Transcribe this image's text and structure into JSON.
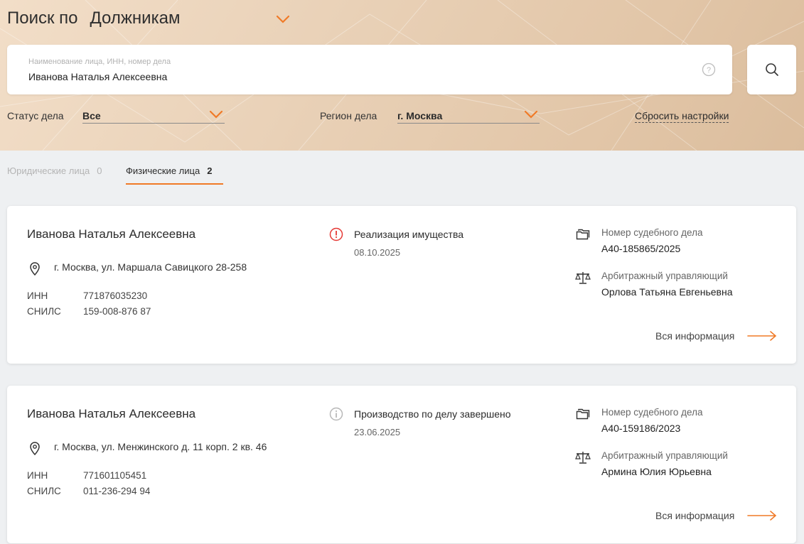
{
  "header": {
    "title_prefix": "Поиск по",
    "title_select": "Должникам",
    "search": {
      "placeholder": "Наименование лица, ИНН, номер дела",
      "value": "Иванова Наталья Алексеевна"
    },
    "filters": [
      {
        "label": "Статус дела",
        "value": "Все"
      },
      {
        "label": "Регион дела",
        "value": "г. Москва"
      }
    ],
    "reset_label": "Сбросить настройки"
  },
  "tabs": [
    {
      "label": "Юридические лица",
      "count": "0",
      "active": false
    },
    {
      "label": "Физические лица",
      "count": "2",
      "active": true
    }
  ],
  "results": [
    {
      "name": "Иванова Наталья Алексеевна",
      "address": "г. Москва, ул. Маршала Савицкого 28-258",
      "inn_label": "ИНН",
      "inn": "771876035230",
      "snils_label": "СНИЛС",
      "snils": "159-008-876 87",
      "status": "Реализация имущества",
      "status_date": "08.10.2025",
      "status_color": "#e53935",
      "case_label": "Номер судебного дела",
      "case_number": "А40-185865/2025",
      "manager_label": "Арбитражный управляющий",
      "manager": "Орлова Татьяна Евгеньевна",
      "more_label": "Вся информация"
    },
    {
      "name": "Иванова Наталья Алексеевна",
      "address": "г. Москва, ул. Менжинского д. 11 корп. 2 кв. 46",
      "inn_label": "ИНН",
      "inn": "771601105451",
      "snils_label": "СНИЛС",
      "snils": "011-236-294 94",
      "status": "Производство по делу завершено",
      "status_date": "23.06.2025",
      "status_color": "#b8b8b8",
      "case_label": "Номер судебного дела",
      "case_number": "А40-159186/2023",
      "manager_label": "Арбитражный управляющий",
      "manager": "Армина Юлия Юрьевна",
      "more_label": "Вся информация"
    }
  ],
  "colors": {
    "accent": "#f07a27",
    "alert": "#e53935",
    "muted": "#b8b8b8"
  }
}
